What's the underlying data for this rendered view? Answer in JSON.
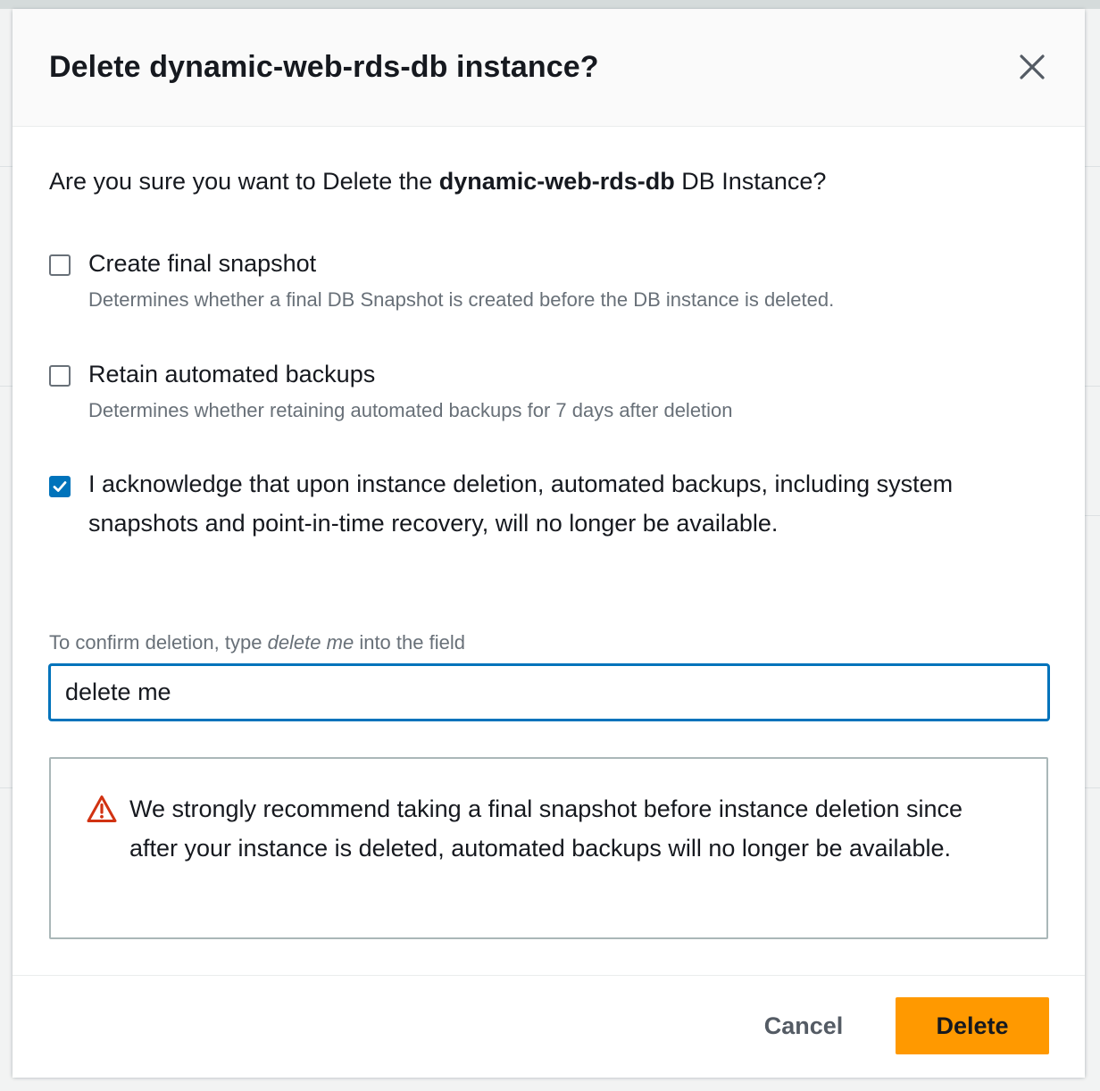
{
  "modal": {
    "title": "Delete dynamic-web-rds-db instance?",
    "intro_prefix": "Are you sure you want to Delete the ",
    "intro_instance": "dynamic-web-rds-db",
    "intro_suffix": " DB Instance?",
    "options": [
      {
        "label": "Create final snapshot",
        "description": "Determines whether a final DB Snapshot is created before the DB instance is deleted.",
        "checked": false
      },
      {
        "label": "Retain automated backups",
        "description": "Determines whether retaining automated backups for 7 days after deletion",
        "checked": false
      }
    ],
    "acknowledge": {
      "label": "I acknowledge that upon instance deletion, automated backups, including system snapshots and point-in-time recovery, will no longer be available.",
      "checked": true
    },
    "confirm": {
      "label_prefix": "To confirm deletion, type ",
      "label_keyword": "delete me",
      "label_suffix": " into the field",
      "value": "delete me"
    },
    "warning": {
      "icon": "warning-icon",
      "text": "We strongly recommend taking a final snapshot before instance deletion since after your instance is deleted, automated backups will no longer be available."
    },
    "footer": {
      "cancel_label": "Cancel",
      "delete_label": "Delete"
    }
  },
  "colors": {
    "primary_button": "#ff9900",
    "focus_blue": "#0073bb",
    "warning_red": "#d13212"
  }
}
